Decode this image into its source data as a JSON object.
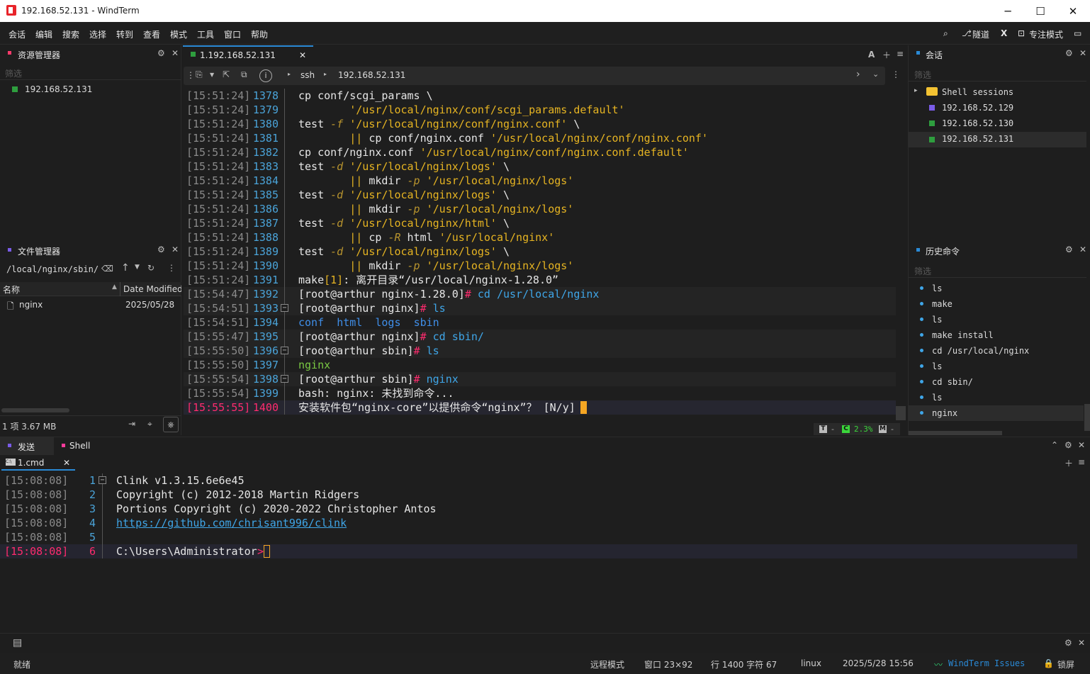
{
  "window": {
    "title": "192.168.52.131 - WindTerm",
    "min": "─",
    "max": "☐",
    "close": "✕"
  },
  "menu": [
    "会话",
    "编辑",
    "搜索",
    "选择",
    "转到",
    "查看",
    "模式",
    "工具",
    "窗口",
    "帮助"
  ],
  "menu_right": {
    "tunnel": "隧道",
    "x": "X",
    "focus": "专注模式"
  },
  "explorer": {
    "title": "资源管理器",
    "filter": "筛选",
    "item": "192.168.52.131"
  },
  "files": {
    "title": "文件管理器",
    "path": "/local/nginx/sbin/",
    "col_name": "名称",
    "col_date": "Date Modified",
    "row_name": "nginx",
    "row_date": "2025/05/28",
    "footer": "1 项 3.67 MB"
  },
  "tab": {
    "label": "1.192.168.52.131",
    "close": "✕"
  },
  "toolbar": {
    "proto": "ssh",
    "host": "192.168.52.131",
    "tab_a": "A"
  },
  "terminal": {
    "lines": [
      {
        "ts": "[15:51:24]",
        "ln": "1378",
        "html": "cp conf/scgi_params \\"
      },
      {
        "ts": "[15:51:24]",
        "ln": "1379",
        "html": "        <span class='s'>'/usr/local/nginx/conf/scgi_params.default'</span>"
      },
      {
        "ts": "[15:51:24]",
        "ln": "1380",
        "html": "test <span class='o'>-f</span> <span class='s'>'/usr/local/nginx/conf/nginx.conf'</span> \\"
      },
      {
        "ts": "[15:51:24]",
        "ln": "1381",
        "html": "        <span class='s'>||</span> cp conf/nginx.conf <span class='s'>'/usr/local/nginx/conf/nginx.conf'</span>"
      },
      {
        "ts": "[15:51:24]",
        "ln": "1382",
        "html": "cp conf/nginx.conf <span class='s'>'/usr/local/nginx/conf/nginx.conf.default'</span>"
      },
      {
        "ts": "[15:51:24]",
        "ln": "1383",
        "html": "test <span class='o'>-d</span> <span class='s'>'/usr/local/nginx/logs'</span> \\"
      },
      {
        "ts": "[15:51:24]",
        "ln": "1384",
        "html": "        <span class='s'>||</span> mkdir <span class='o'>-p</span> <span class='s'>'/usr/local/nginx/logs'</span>"
      },
      {
        "ts": "[15:51:24]",
        "ln": "1385",
        "html": "test <span class='o'>-d</span> <span class='s'>'/usr/local/nginx/logs'</span> \\"
      },
      {
        "ts": "[15:51:24]",
        "ln": "1386",
        "html": "        <span class='s'>||</span> mkdir <span class='o'>-p</span> <span class='s'>'/usr/local/nginx/logs'</span>"
      },
      {
        "ts": "[15:51:24]",
        "ln": "1387",
        "html": "test <span class='o'>-d</span> <span class='s'>'/usr/local/nginx/html'</span> \\"
      },
      {
        "ts": "[15:51:24]",
        "ln": "1388",
        "html": "        <span class='s'>||</span> cp <span class='o'>-R</span> html <span class='s'>'/usr/local/nginx'</span>"
      },
      {
        "ts": "[15:51:24]",
        "ln": "1389",
        "html": "test <span class='o'>-d</span> <span class='s'>'/usr/local/nginx/logs'</span> \\"
      },
      {
        "ts": "[15:51:24]",
        "ln": "1390",
        "html": "        <span class='s'>||</span> mkdir <span class='o'>-p</span> <span class='s'>'/usr/local/nginx/logs'</span>"
      },
      {
        "ts": "[15:51:24]",
        "ln": "1391",
        "html": "make<span class='s'>[1]</span>: 离开目录“/usr/local/nginx-1.28.0”"
      },
      {
        "ts": "[15:54:47]",
        "ln": "1392",
        "html": "[root@arthur nginx-1.28.0]<span class='pr'>#</span> <span class='cm'>cd /usr/local/nginx</span>"
      },
      {
        "ts": "[15:54:51]",
        "ln": "1393",
        "html": "[root@arthur nginx]<span class='pr'>#</span> <span class='cm'>ls</span>"
      },
      {
        "ts": "[15:54:51]",
        "ln": "1394",
        "html": "<span class='bl'>conf</span>  <span class='bl'>html</span>  <span class='bl'>logs</span>  <span class='bl'>sbin</span>"
      },
      {
        "ts": "[15:55:47]",
        "ln": "1395",
        "html": "[root@arthur nginx]<span class='pr'>#</span> <span class='cm'>cd sbin/</span>"
      },
      {
        "ts": "[15:55:50]",
        "ln": "1396",
        "html": "[root@arthur sbin]<span class='pr'>#</span> <span class='cm'>ls</span>"
      },
      {
        "ts": "[15:55:50]",
        "ln": "1397",
        "html": "<span class='gr'>nginx</span>"
      },
      {
        "ts": "[15:55:54]",
        "ln": "1398",
        "html": "[root@arthur sbin]<span class='pr'>#</span> <span class='cm'>nginx</span>"
      },
      {
        "ts": "[15:55:54]",
        "ln": "1399",
        "html": "bash: nginx: 未找到命令..."
      },
      {
        "ts": "[15:55:55]",
        "ln": "1400",
        "html": "安装软件包“nginx-core”以提供命令“nginx”？ [N/y] "
      }
    ]
  },
  "term_status": {
    "t": "T",
    "c": "C",
    "pct": "2.3%",
    "m": "M"
  },
  "sessions": {
    "title": "会话",
    "filter": "筛选",
    "group": "Shell sessions",
    "items": [
      "192.168.52.129",
      "192.168.52.130",
      "192.168.52.131"
    ],
    "colors": [
      "#7a5ce8",
      "#2e9e3e",
      "#2e9e3e"
    ]
  },
  "history": {
    "title": "历史命令",
    "filter": "筛选",
    "items": [
      "ls",
      "make",
      "ls",
      "make install",
      "cd /usr/local/nginx",
      "ls",
      "cd sbin/",
      "ls",
      "nginx"
    ]
  },
  "bottom": {
    "tab_send": "发送",
    "tab_shell": "Shell",
    "subtab": "1.cmd",
    "lines": [
      {
        "ts": "[15:08:08]",
        "ln": "1",
        "text": "Clink v1.3.15.6e6e45"
      },
      {
        "ts": "[15:08:08]",
        "ln": "2",
        "text": "Copyright (c) 2012-2018 Martin Ridgers"
      },
      {
        "ts": "[15:08:08]",
        "ln": "3",
        "text": "Portions Copyright (c) 2020-2022 Christopher Antos"
      },
      {
        "ts": "[15:08:08]",
        "ln": "4",
        "text": "https://github.com/chrisant996/clink"
      },
      {
        "ts": "[15:08:08]",
        "ln": "5",
        "text": ""
      },
      {
        "ts": "[15:08:08]",
        "ln": "6",
        "text": "C:\\Users\\Administrator"
      }
    ]
  },
  "status": {
    "ready": "就绪",
    "remote": "远程模式",
    "window": "窗口 23×92",
    "pos": "行 1400 字符 67",
    "os": "linux",
    "datetime": "2025/5/28 15:56",
    "issues": "WindTerm Issues",
    "lock": "锁屏"
  }
}
